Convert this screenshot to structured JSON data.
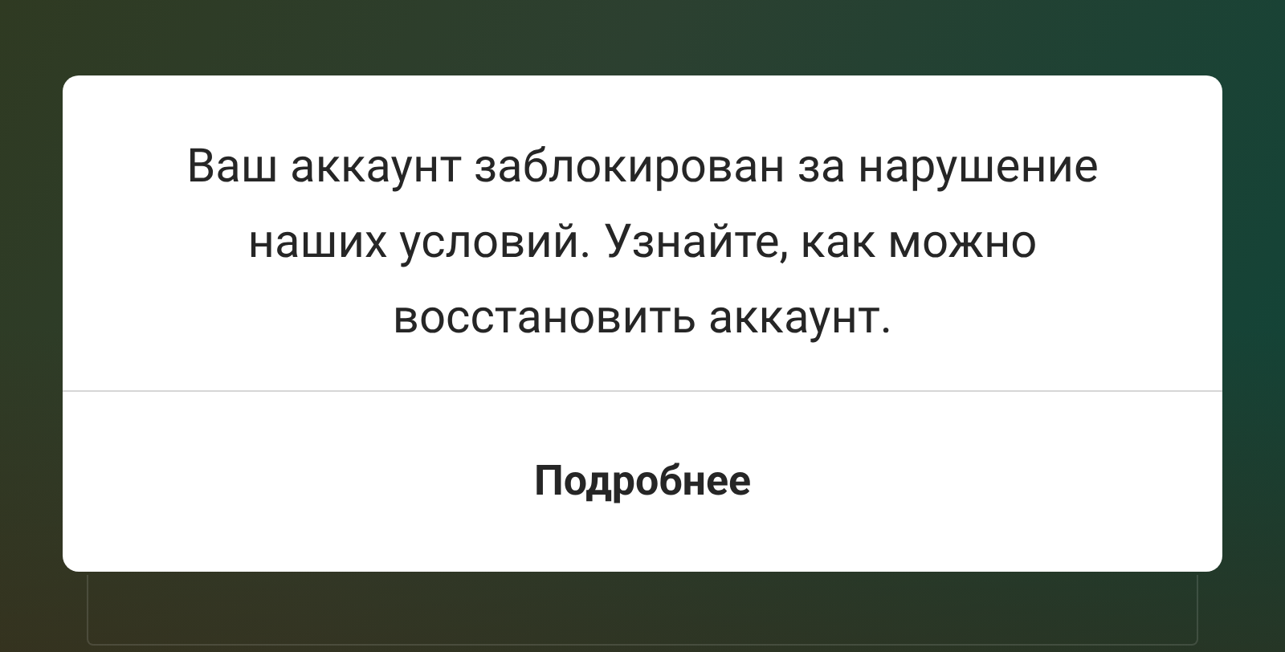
{
  "dialog": {
    "message": "Ваш аккаунт заблокирован за нарушение наших условий. Узнайте, как можно восстановить аккаунт.",
    "buttons": [
      "Подробнее"
    ]
  }
}
